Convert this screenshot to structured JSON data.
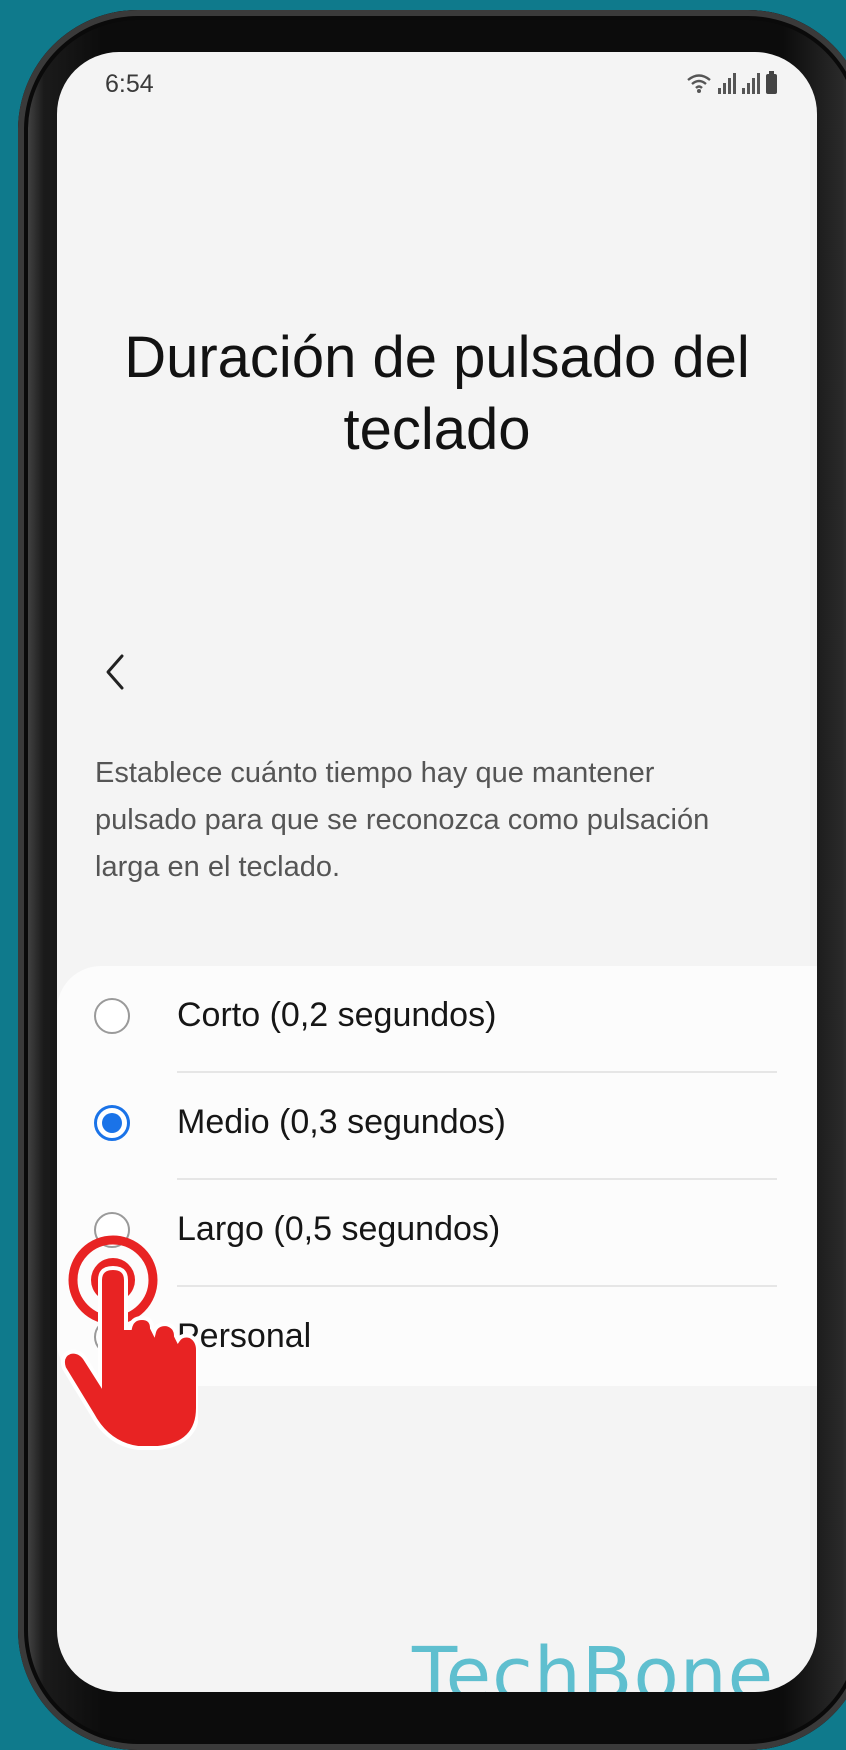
{
  "status_bar": {
    "time": "6:54"
  },
  "page": {
    "title": "Duración de pulsado del teclado"
  },
  "description": "Establece cuánto tiempo hay que mantener pulsado para que se reconozca como pulsación larga en el teclado.",
  "options": [
    {
      "label": "Corto (0,2 segundos)",
      "selected": false
    },
    {
      "label": "Medio (0,3 segundos)",
      "selected": true
    },
    {
      "label": "Largo (0,5 segundos)",
      "selected": false
    },
    {
      "label": "Personal",
      "selected": false
    }
  ],
  "watermark": "TechBone",
  "colors": {
    "accent": "#1a73e8",
    "background": "#0f7a8c",
    "tap_indicator": "#e82323"
  }
}
